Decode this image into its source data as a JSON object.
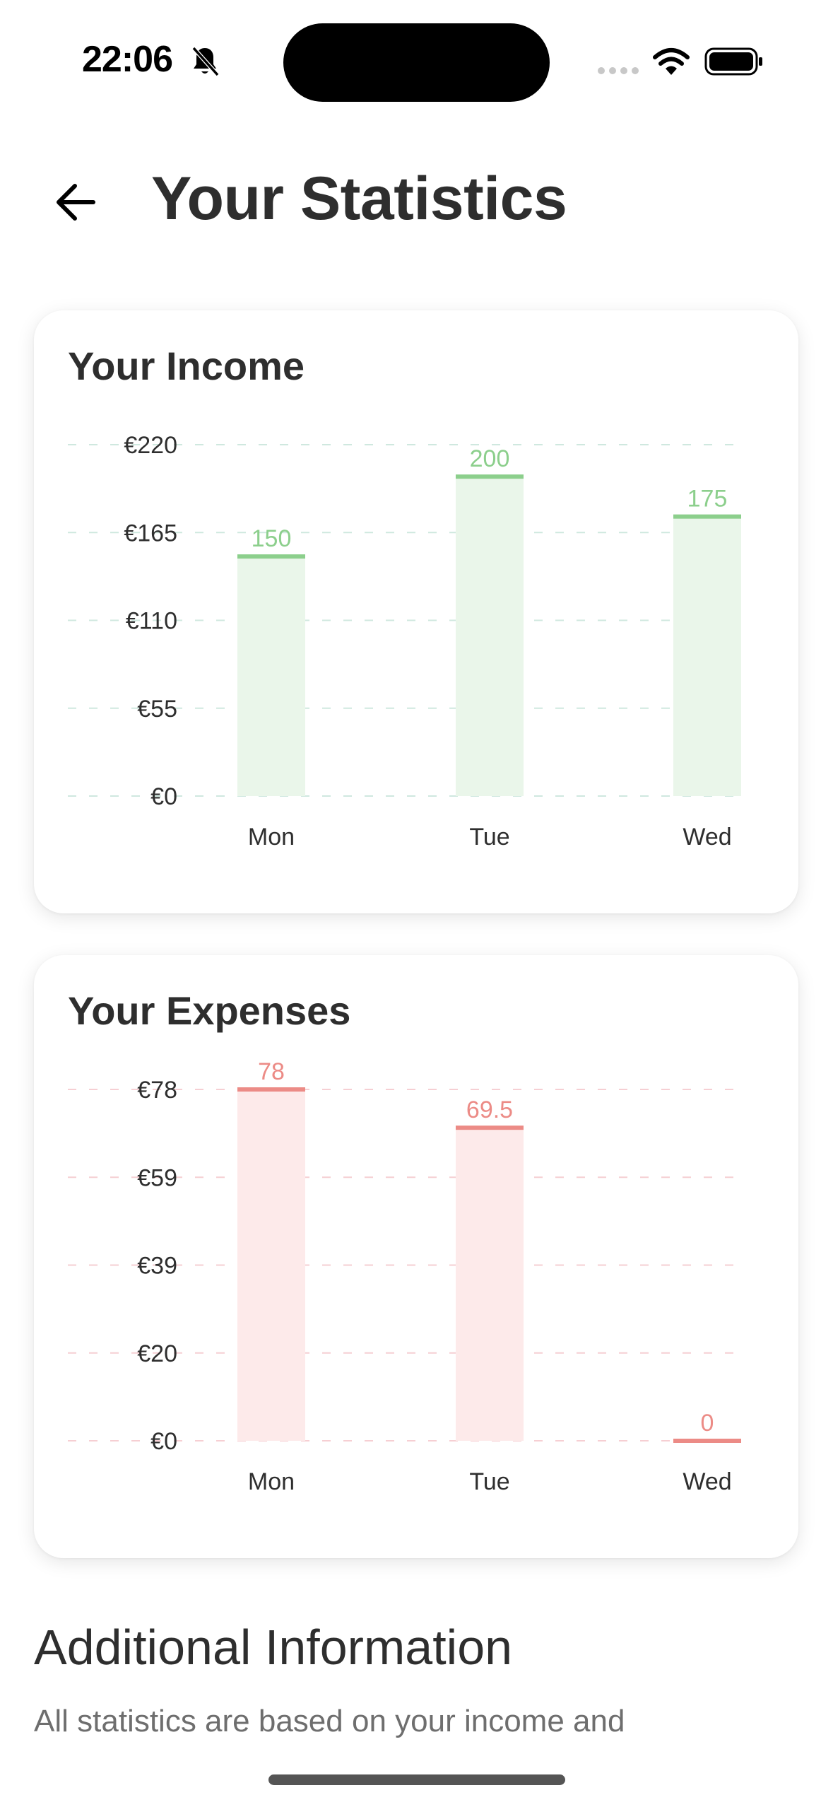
{
  "status_bar": {
    "time": "22:06",
    "icons": [
      "bell-slash-icon",
      "cellular-signal-icon",
      "wifi-icon",
      "battery-icon"
    ]
  },
  "header": {
    "title": "Your Statistics",
    "back_icon": "arrow-left-icon"
  },
  "income_card": {
    "title": "Your Income"
  },
  "expenses_card": {
    "title": "Your Expenses"
  },
  "additional": {
    "title": "Additional Information",
    "text": "All statistics are based on your income and"
  },
  "colors": {
    "income_line": "#8ccf8c",
    "income_fill": "#eaf6ea",
    "income_grid": "#cfe8df",
    "expense_line": "#ec8b86",
    "expense_fill": "#fdeaea",
    "expense_grid": "#f6cfd3",
    "axis_text": "#2e2e2e"
  },
  "chart_data": [
    {
      "type": "bar",
      "title": "Your Income",
      "categories": [
        "Mon",
        "Tue",
        "Wed"
      ],
      "values": [
        150,
        200,
        175
      ],
      "value_labels": [
        "150",
        "200",
        "175"
      ],
      "y_ticks": [
        "€0",
        "€55",
        "€110",
        "€165",
        "€220"
      ],
      "ylim": [
        0,
        220
      ],
      "grid": true
    },
    {
      "type": "bar",
      "title": "Your Expenses",
      "categories": [
        "Mon",
        "Tue",
        "Wed"
      ],
      "values": [
        78,
        69.5,
        0
      ],
      "value_labels": [
        "78",
        "69.5",
        "0"
      ],
      "y_ticks": [
        "€0",
        "€20",
        "€39",
        "€59",
        "€78"
      ],
      "ylim": [
        0,
        78
      ],
      "grid": true
    }
  ]
}
